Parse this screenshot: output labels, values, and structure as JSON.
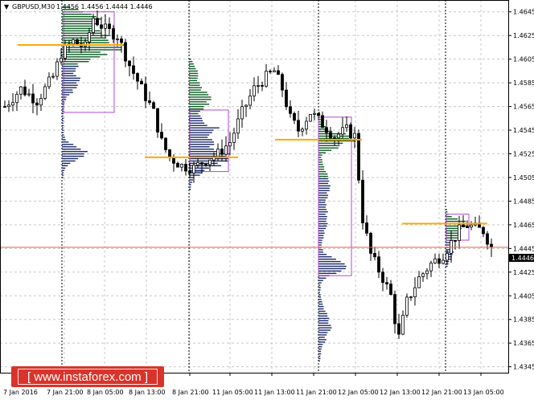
{
  "header": {
    "symbol": "GBPUSD,M30",
    "quote": "1.4456 1.4456 1.4444 1.4446"
  },
  "watermark": {
    "text": "[ www.instaforex.com ]"
  },
  "current_price_label": "1.4446",
  "colors": {
    "candle": "#000000",
    "grid": "#c8c8c8",
    "profile_top": "#0b5a23",
    "profile_bottom": "#1c2a6a",
    "value_area_box": "#b04ad0",
    "poc_line": "#ffaa00",
    "current_price_line": "#e8643c",
    "watermark_bg": "#d9342b"
  },
  "chart_data": {
    "type": "candlestick",
    "symbol": "GBPUSD",
    "timeframe": "M30",
    "ylim": [
      1.434,
      1.4655
    ],
    "y_ticks": [
      "1.4645",
      "1.4625",
      "1.4605",
      "1.4585",
      "1.4565",
      "1.4545",
      "1.4525",
      "1.4505",
      "1.4485",
      "1.4465",
      "1.4445",
      "1.4425",
      "1.4405",
      "1.4385",
      "1.4365",
      "1.4345"
    ],
    "x_ticks": [
      "7 Jan 2016",
      "7 Jan 21:00",
      "8 Jan 05:00",
      "8 Jan 13:00",
      "8 Jan 21:00",
      "11 Jan 05:00",
      "11 Jan 13:00",
      "11 Jan 21:00",
      "12 Jan 05:00",
      "12 Jan 13:00",
      "12 Jan 21:00",
      "13 Jan 05:00"
    ],
    "grid": true,
    "session_separators": [
      "7 Jan 21:00",
      "8 Jan 21:00",
      "11 Jan 21:00",
      "12 Jan 21:00"
    ],
    "close_path": [
      [
        0,
        1.4565
      ],
      [
        4,
        1.458
      ],
      [
        8,
        1.457
      ],
      [
        12,
        1.459
      ],
      [
        14,
        1.461
      ],
      [
        17,
        1.462
      ],
      [
        20,
        1.4615
      ],
      [
        22,
        1.464
      ],
      [
        25,
        1.463
      ],
      [
        28,
        1.4625
      ],
      [
        31,
        1.46
      ],
      [
        34,
        1.458
      ],
      [
        37,
        1.456
      ],
      [
        39,
        1.4535
      ],
      [
        41,
        1.4522
      ],
      [
        44,
        1.4515
      ],
      [
        47,
        1.4513
      ],
      [
        50,
        1.452
      ],
      [
        53,
        1.4525
      ],
      [
        56,
        1.4535
      ],
      [
        59,
        1.456
      ],
      [
        62,
        1.458
      ],
      [
        65,
        1.459
      ],
      [
        67,
        1.4595
      ],
      [
        69,
        1.458
      ],
      [
        71,
        1.4555
      ],
      [
        73,
        1.4545
      ],
      [
        76,
        1.456
      ],
      [
        79,
        1.455
      ],
      [
        82,
        1.454
      ],
      [
        85,
        1.4545
      ],
      [
        87,
        1.454
      ],
      [
        88,
        1.4505
      ],
      [
        89,
        1.447
      ],
      [
        91,
        1.444
      ],
      [
        94,
        1.442
      ],
      [
        96,
        1.4405
      ],
      [
        97,
        1.4385
      ],
      [
        98,
        1.437
      ],
      [
        100,
        1.44
      ],
      [
        103,
        1.442
      ],
      [
        106,
        1.4432
      ],
      [
        109,
        1.444
      ],
      [
        111,
        1.445
      ],
      [
        113,
        1.446
      ],
      [
        115,
        1.4465
      ],
      [
        117,
        1.4462
      ],
      [
        119,
        1.446
      ],
      [
        121,
        1.4446
      ]
    ],
    "volume_profiles": [
      {
        "session": "7 Jan 21:00 – 8 Jan 21:00",
        "poc": 1.4617,
        "value_area": [
          1.456,
          1.4645
        ]
      },
      {
        "session": "8 Jan 21:00 – 11 Jan 21:00",
        "poc": 1.4522,
        "value_area": [
          1.451,
          1.4562
        ]
      },
      {
        "session": "11 Jan 21:00 – 12 Jan 21:00",
        "poc": 1.4537,
        "value_area": [
          1.4422,
          1.4556
        ]
      },
      {
        "session": "12 Jan 21:00 – now",
        "poc": 1.4466,
        "value_area": [
          1.4452,
          1.4474
        ]
      }
    ],
    "current_price": 1.4446
  }
}
